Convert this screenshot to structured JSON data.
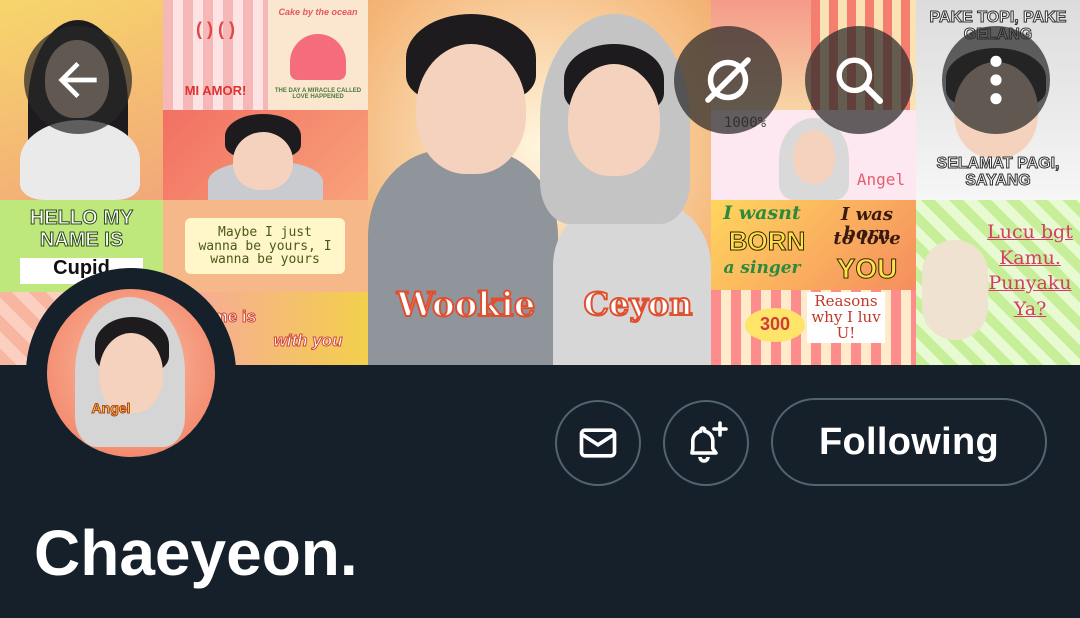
{
  "header": {
    "banner_stickers": {
      "hello_line1": "HELLO MY",
      "hello_line2": "NAME IS",
      "cupid": "Cupid",
      "mi_amor": "MI AMOR!",
      "cake_top": "Cake by the ocean",
      "cake_bottom": "THE DAY A MIRACLE CALLED LOVE HAPPENED",
      "maybe": "Maybe I just wanna be yours, I wanna be yours",
      "home_is": "Home is",
      "with_you": "with you",
      "wookie": "Wookie",
      "ceyon": "Ceyon",
      "pake_topi": "PAKE TOPI, PAKE GELANG",
      "selamat_pagi": "SELAMAT PAGI, SAYANG",
      "percent": "1000%",
      "angel": "Angel",
      "i_wasnt": "I wasnt",
      "born": "BORN",
      "a_singer": "a singer",
      "i_was_born": "I was born",
      "to_love": "to love",
      "you": "YOU",
      "reasons_count": "300",
      "reasons": "Reasons why I luv U!",
      "lucu": "Lucu bgt Kamu. Punyaku Ya?"
    },
    "back_icon": "arrow-left-icon",
    "hide_icon": "eye-slash-icon",
    "search_icon": "search-icon",
    "more_icon": "more-vertical-icon"
  },
  "profile": {
    "display_name": "Chaeyeon.",
    "avatar_caption": "Angel",
    "message_icon": "envelope-icon",
    "notify_icon": "bell-plus-icon",
    "follow_label": "Following"
  },
  "colors": {
    "background": "#15202b",
    "button_border": "#536471",
    "text": "#ffffff"
  }
}
